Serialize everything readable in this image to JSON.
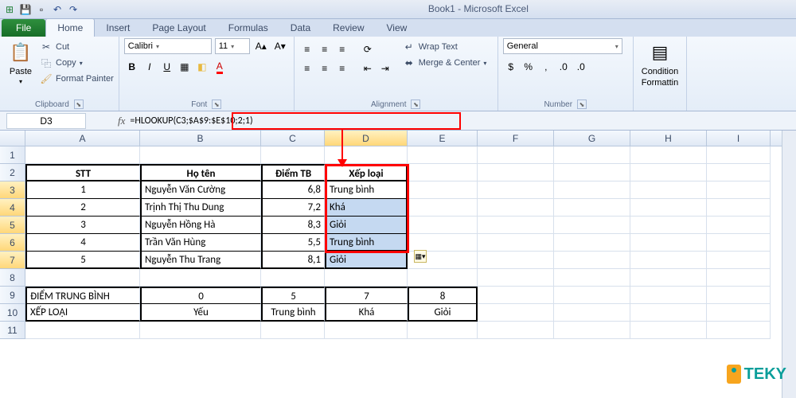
{
  "app": {
    "title": "Book1 - Microsoft Excel"
  },
  "tabs": {
    "file": "File",
    "home": "Home",
    "insert": "Insert",
    "pagelayout": "Page Layout",
    "formulas": "Formulas",
    "data": "Data",
    "review": "Review",
    "view": "View"
  },
  "clipboard": {
    "paste": "Paste",
    "cut": "Cut",
    "copy": "Copy",
    "fp": "Format Painter",
    "title": "Clipboard"
  },
  "font": {
    "name": "Calibri",
    "size": "11",
    "title": "Font"
  },
  "alignment": {
    "wrap": "Wrap Text",
    "merge": "Merge & Center",
    "title": "Alignment"
  },
  "number": {
    "fmt": "General",
    "title": "Number"
  },
  "styles": {
    "cf": "Conditional\nFormatting",
    "cf1": "Condition",
    "cf2": "Formattin"
  },
  "namebox": "D3",
  "formula": "=HLOOKUP(C3;$A$9:$E$10;2;1)",
  "cols": [
    "A",
    "B",
    "C",
    "D",
    "E",
    "F",
    "G",
    "H",
    "I"
  ],
  "rows": [
    "1",
    "2",
    "3",
    "4",
    "5",
    "6",
    "7",
    "8",
    "9",
    "10",
    "11"
  ],
  "hdr": {
    "stt": "STT",
    "ht": "Họ tên",
    "dtb": "Điểm TB",
    "xl": "Xếp loại"
  },
  "data": [
    {
      "stt": "1",
      "ten": "Nguyễn Văn Cường",
      "diem": "6,8",
      "xl": "Trung bình"
    },
    {
      "stt": "2",
      "ten": "Trịnh Thị Thu Dung",
      "diem": "7,2",
      "xl": "Khá"
    },
    {
      "stt": "3",
      "ten": "Nguyễn Hồng Hà",
      "diem": "8,3",
      "xl": "Giỏi"
    },
    {
      "stt": "4",
      "ten": "Trần Văn Hùng",
      "diem": "5,5",
      "xl": "Trung bình"
    },
    {
      "stt": "5",
      "ten": "Nguyễn Thu Trang",
      "diem": "8,1",
      "xl": "Giỏi"
    }
  ],
  "lookup": {
    "r1a": "ĐIỂM TRUNG BÌNH",
    "r1b": "0",
    "r1c": "5",
    "r1d": "7",
    "r1e": "8",
    "r2a": "XẾP LOẠI",
    "r2b": "Yếu",
    "r2c": "Trung bình",
    "r2d": "Khá",
    "r2e": "Giỏi"
  },
  "logo": {
    "t": "TEKY"
  }
}
